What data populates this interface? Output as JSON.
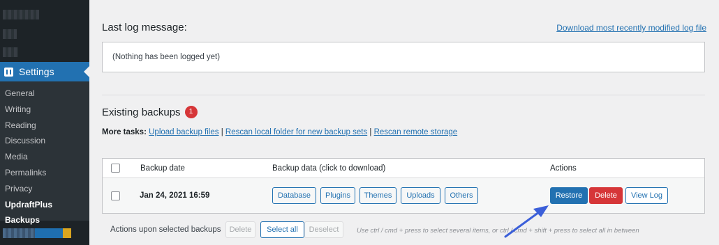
{
  "sidebar": {
    "settings_label": "Settings",
    "items": [
      {
        "label": "General"
      },
      {
        "label": "Writing"
      },
      {
        "label": "Reading"
      },
      {
        "label": "Discussion"
      },
      {
        "label": "Media"
      },
      {
        "label": "Permalinks"
      },
      {
        "label": "Privacy"
      },
      {
        "label": "UpdraftPlus Backups"
      }
    ]
  },
  "log": {
    "title": "Last log message:",
    "download_link": "Download most recently modified log file",
    "message": "(Nothing has been logged yet)"
  },
  "backups": {
    "title": "Existing backups",
    "count": "1",
    "more_tasks_label": "More tasks:",
    "tasks": [
      "Upload backup files",
      "Rescan local folder for new backup sets",
      "Rescan remote storage"
    ],
    "separator": "|",
    "columns": {
      "date": "Backup date",
      "data": "Backup data (click to download)",
      "actions": "Actions"
    },
    "rows": [
      {
        "date": "Jan 24, 2021 16:59",
        "data_buttons": [
          "Database",
          "Plugins",
          "Themes",
          "Uploads",
          "Others"
        ],
        "restore": "Restore",
        "delete": "Delete",
        "view_log": "View Log"
      }
    ],
    "bulk": {
      "label": "Actions upon selected backups",
      "delete": "Delete",
      "select_all": "Select all",
      "deselect": "Deselect",
      "hint": "Use ctrl / cmd + press to select several items, or ctrl / cmd + shift + press to select all in between"
    }
  },
  "colors": {
    "accent": "#2271b1",
    "danger": "#d63638",
    "sidebar_bg": "#1d2327",
    "arrow": "#3b5fd9"
  },
  "icons": {
    "settings": "settings-icon",
    "pointer": "arrow-pointer-icon"
  }
}
